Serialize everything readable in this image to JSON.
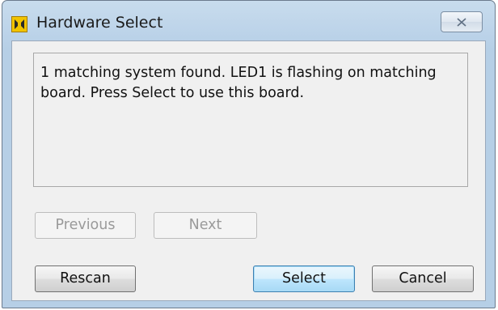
{
  "window": {
    "title": "Hardware Select",
    "icon": "labview-app-icon",
    "close_icon": "close-x-icon"
  },
  "message": {
    "text": "1 matching system found. LED1 is flashing on matching board. Press Select to use this board."
  },
  "navigation": {
    "previous_label": "Previous",
    "previous_enabled": false,
    "next_label": "Next",
    "next_enabled": false
  },
  "actions": {
    "rescan_label": "Rescan",
    "select_label": "Select",
    "select_is_default": true,
    "cancel_label": "Cancel"
  },
  "colors": {
    "titlebar": "#bcd3e9",
    "dialog_background": "#f0f0f0",
    "default_button_accent": "#3c7fb1",
    "app_icon": "#f2c400"
  }
}
